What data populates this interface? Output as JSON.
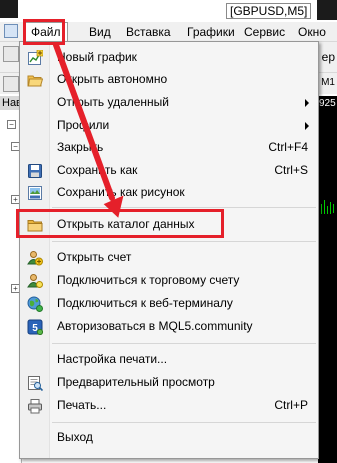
{
  "window": {
    "chart_title": "[GBPUSD,M5]"
  },
  "menubar": {
    "items": [
      {
        "label": "Файл"
      },
      {
        "label": "Вид"
      },
      {
        "label": "Вставка"
      },
      {
        "label": "Графики"
      },
      {
        "label": "Сервис"
      },
      {
        "label": "Окно"
      }
    ],
    "active": "Файл"
  },
  "toolbar": {
    "right_text": "ер",
    "right_text2": "M1"
  },
  "nav_panel": {
    "header": "Нав"
  },
  "chart": {
    "price_label": "925"
  },
  "file_menu": {
    "items": [
      {
        "label": "Новый график",
        "shortcut": "",
        "icon": "new-chart-icon",
        "submenu": false
      },
      {
        "label": "Открыть автономно",
        "shortcut": "",
        "icon": "open-folder-icon",
        "submenu": false
      },
      {
        "label": "Открыть удаленный",
        "shortcut": "",
        "icon": "",
        "submenu": true
      },
      {
        "label": "Профили",
        "shortcut": "",
        "icon": "",
        "submenu": true
      },
      {
        "label": "Закрыть",
        "shortcut": "Ctrl+F4",
        "icon": "",
        "submenu": false
      },
      {
        "label": "Сохранить как",
        "shortcut": "Ctrl+S",
        "icon": "save-icon",
        "submenu": false
      },
      {
        "label": "Сохранить как рисунок",
        "shortcut": "",
        "icon": "save-picture-icon",
        "submenu": false
      },
      {
        "label": "Открыть каталог данных",
        "shortcut": "",
        "icon": "folder-icon",
        "submenu": false
      },
      {
        "label": "Открыть счет",
        "shortcut": "",
        "icon": "open-account-icon",
        "submenu": false
      },
      {
        "label": "Подключиться к торговому счету",
        "shortcut": "",
        "icon": "login-account-icon",
        "submenu": false
      },
      {
        "label": "Подключиться к веб-терминалу",
        "shortcut": "",
        "icon": "web-terminal-icon",
        "submenu": false
      },
      {
        "label": "Авторизоваться в MQL5.community",
        "shortcut": "",
        "icon": "mql5-icon",
        "submenu": false
      },
      {
        "label": "Настройка печати...",
        "shortcut": "",
        "icon": "",
        "submenu": false
      },
      {
        "label": "Предварительный просмотр",
        "shortcut": "",
        "icon": "print-preview-icon",
        "submenu": false
      },
      {
        "label": "Печать...",
        "shortcut": "Ctrl+P",
        "icon": "printer-icon",
        "submenu": false
      },
      {
        "label": "Выход",
        "shortcut": "",
        "icon": "",
        "submenu": false
      }
    ]
  },
  "colors": {
    "annotation_red": "#e5202a",
    "menu_bg": "#f5f5f5",
    "chart_bg": "#000000",
    "chart_line": "#00c800"
  }
}
